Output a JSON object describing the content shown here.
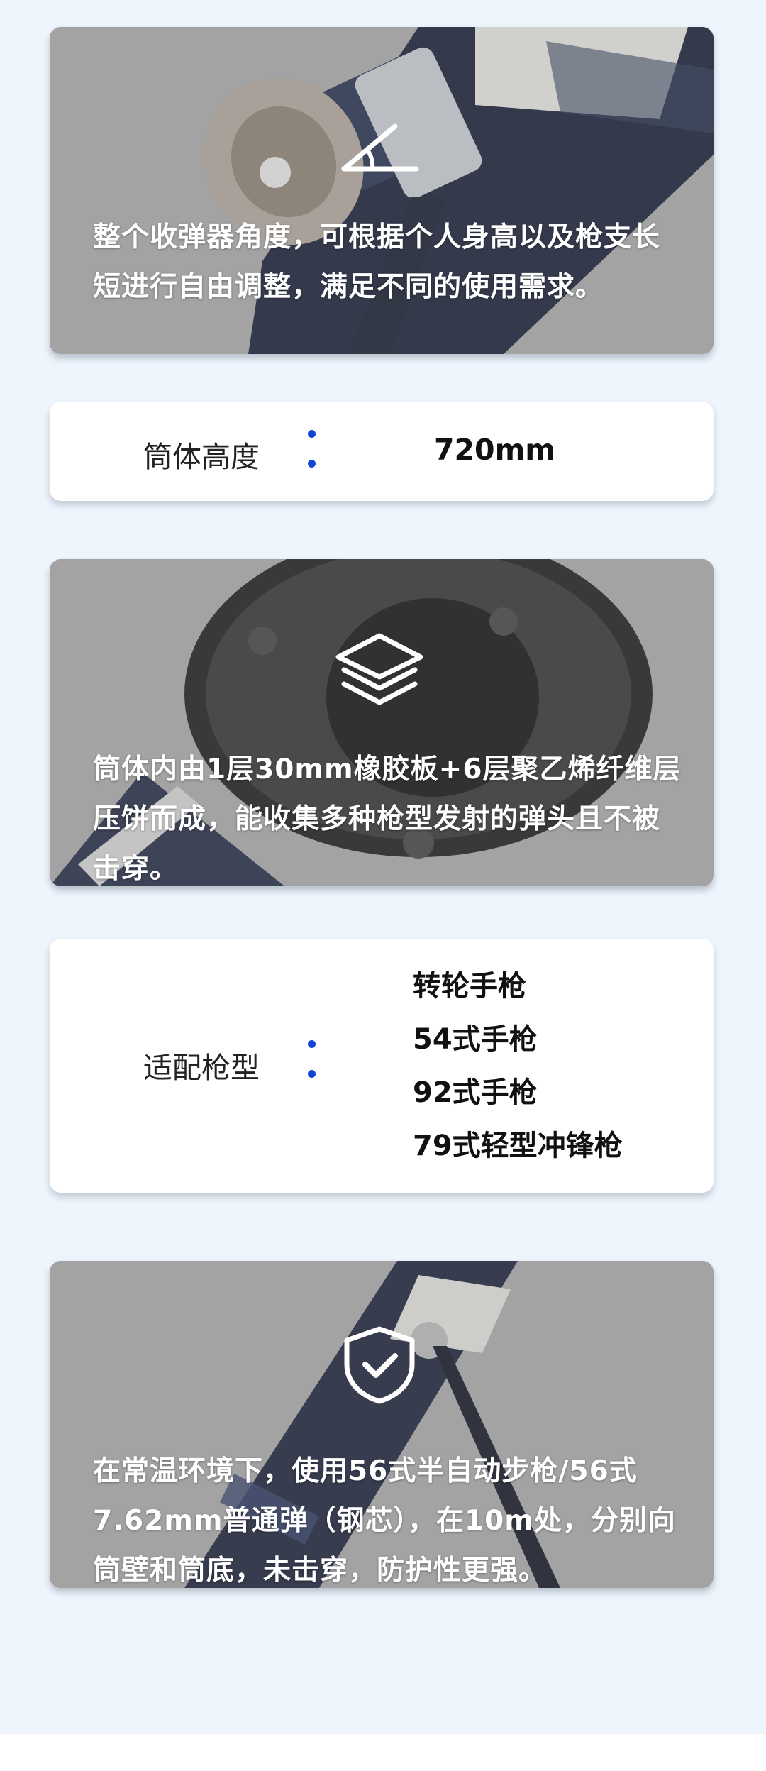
{
  "feature_cards": [
    {
      "icon": "angle-icon",
      "text": "整个收弹器角度，可根据个人身高以及枪支长短进行自由调整，满足不同的使用需求。"
    },
    {
      "icon": "layers-icon",
      "text": "筒体内由1层30mm橡胶板+6层聚乙烯纤维层压饼而成，能收集多种枪型发射的弹头且不被击穿。"
    },
    {
      "icon": "shield-check-icon",
      "text": "在常温环境下，使用56式半自动步枪/56式7.62mm普通弹（钢芯），在10m处，分别向筒壁和筒底，未击穿，防护性更强。"
    }
  ],
  "spec_height": {
    "label": "筒体高度",
    "value": "720mm"
  },
  "spec_guns": {
    "label": "适配枪型",
    "values": [
      "转轮手枪",
      "54式手枪",
      "92式手枪",
      "79式轻型冲锋枪"
    ]
  },
  "colors": {
    "accent": "#1244d6",
    "card_bg": "#ffffff",
    "page_bg": "#eff5fd"
  }
}
